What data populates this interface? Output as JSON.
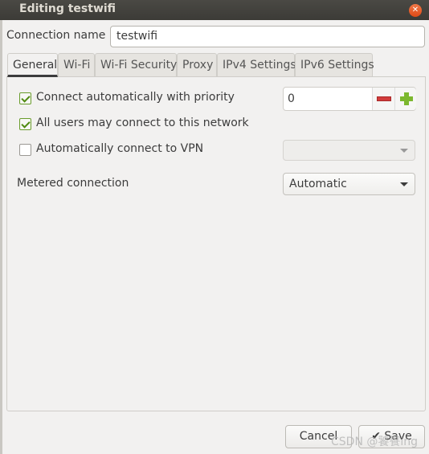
{
  "window": {
    "title": "Editing testwifi",
    "close_icon": "close-icon"
  },
  "connection_name": {
    "label": "Connection name",
    "value": "testwifi"
  },
  "tabs": [
    {
      "label": "General",
      "active": true
    },
    {
      "label": "Wi-Fi"
    },
    {
      "label": "Wi-Fi Security"
    },
    {
      "label": "Proxy"
    },
    {
      "label": "IPv4 Settings"
    },
    {
      "label": "IPv6 Settings"
    }
  ],
  "general": {
    "auto_connect": {
      "label": "Connect automatically with priority",
      "checked": true
    },
    "priority": {
      "value": "0"
    },
    "all_users": {
      "label": "All users may connect to this network",
      "checked": true
    },
    "auto_vpn": {
      "label": "Automatically connect to VPN",
      "checked": false,
      "value": ""
    },
    "metered": {
      "label": "Metered connection",
      "value": "Automatic"
    }
  },
  "buttons": {
    "cancel": "Cancel",
    "save": "Save"
  },
  "watermark": "CSDN @饕餮ing",
  "colors": {
    "titlebar": "#3c3b37",
    "close": "#df4a16",
    "check": "#4f8a10",
    "minus": "#d23c3c",
    "plus": "#7cb82f"
  }
}
